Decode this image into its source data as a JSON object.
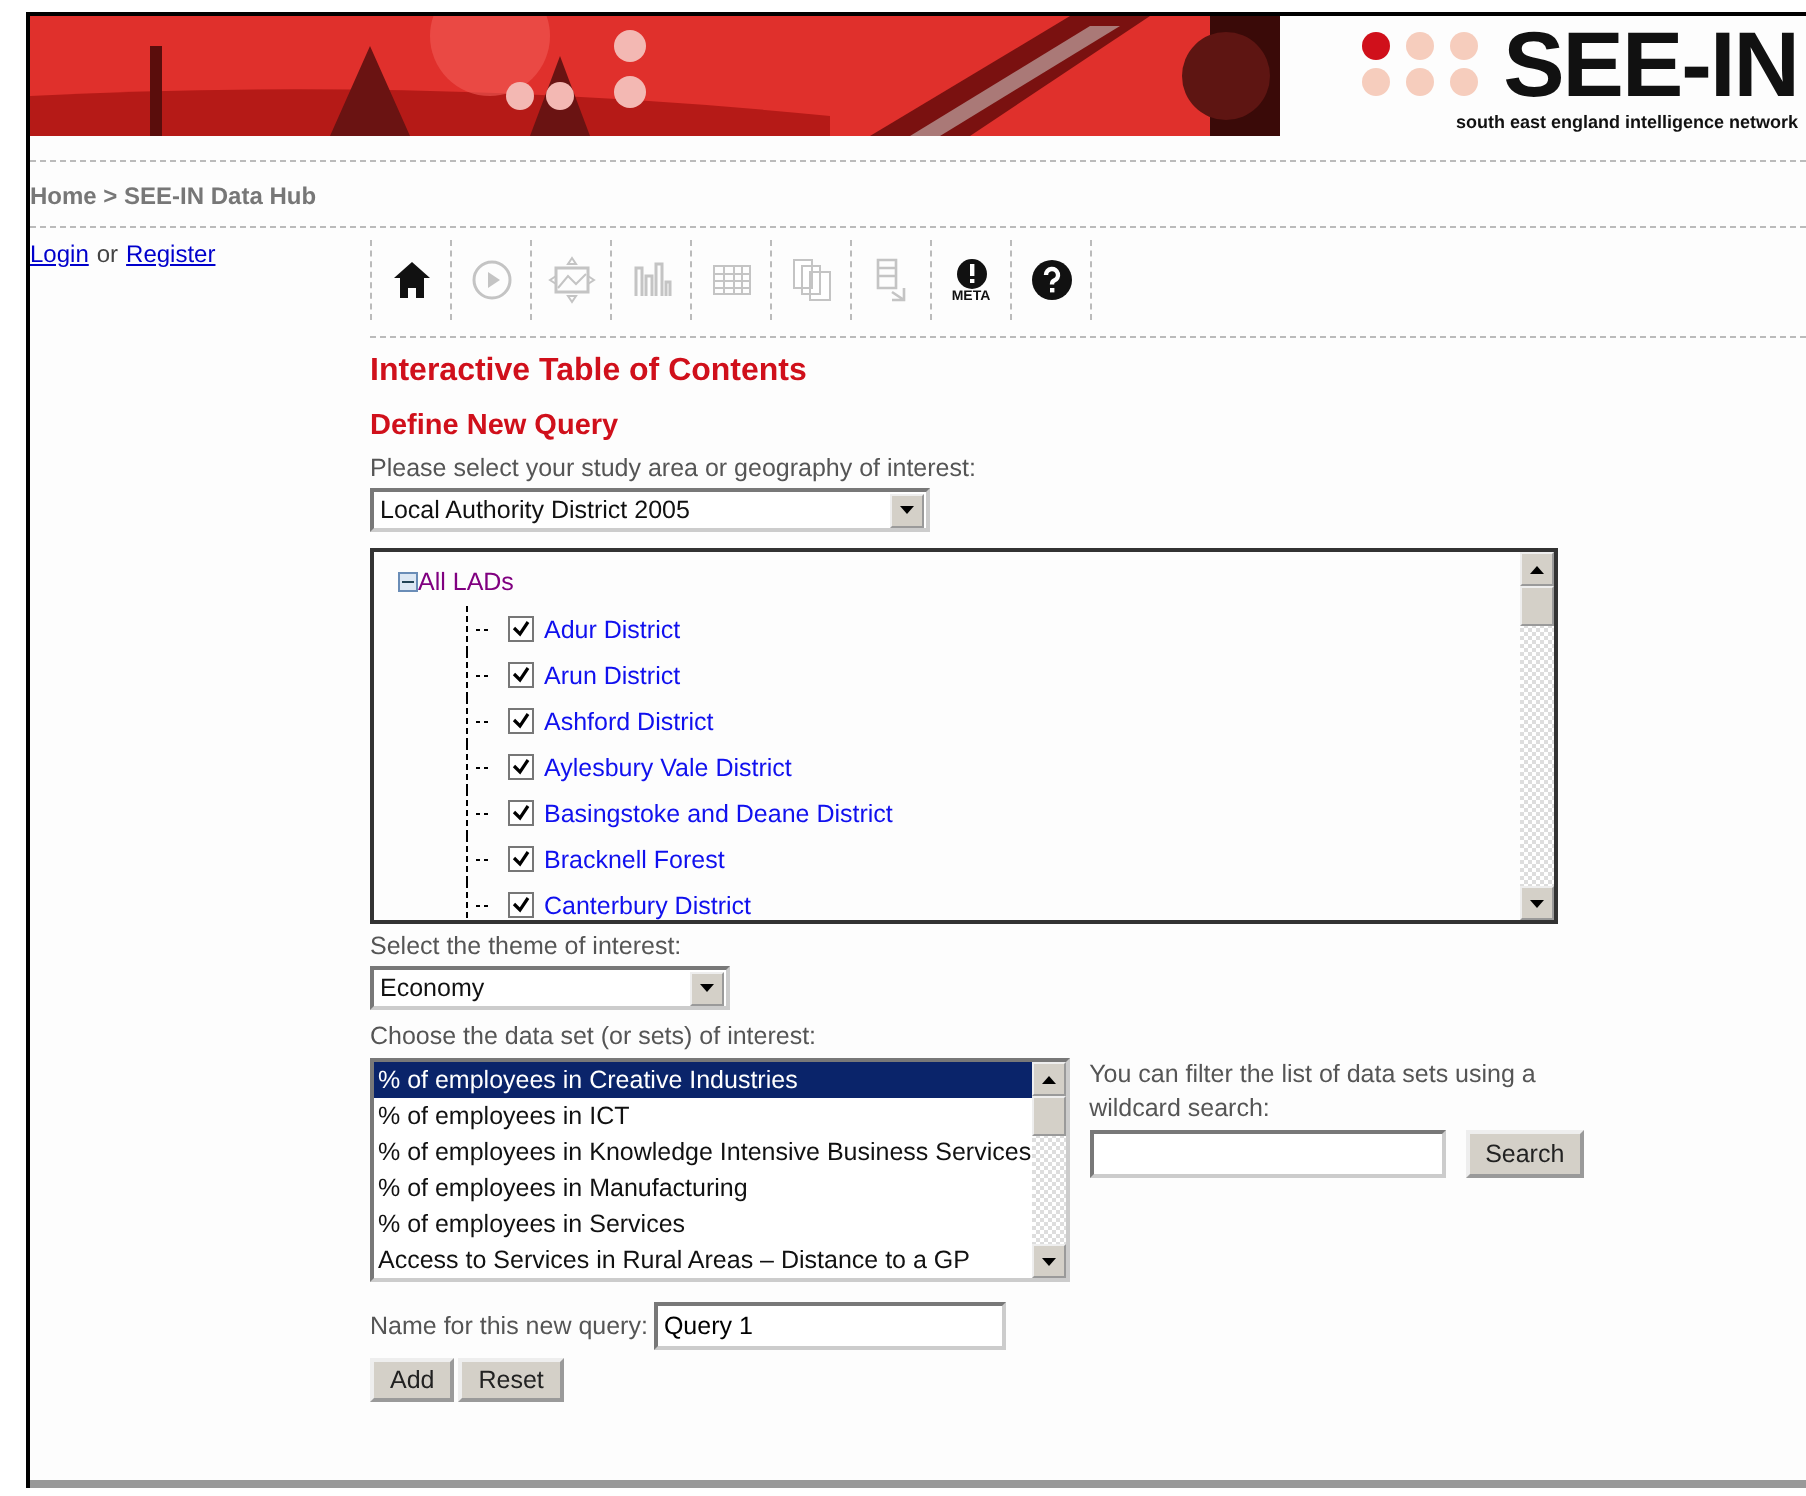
{
  "header": {
    "logo_title": "SEE-IN",
    "logo_tagline": "south east england intelligence network"
  },
  "breadcrumb": "Home > SEE-IN Data Hub",
  "account": {
    "login": "Login",
    "separator": "or",
    "register": "Register"
  },
  "toolbar": [
    {
      "kind": "home",
      "disabled": false
    },
    {
      "kind": "play",
      "disabled": true
    },
    {
      "kind": "map",
      "disabled": true
    },
    {
      "kind": "chart",
      "disabled": true
    },
    {
      "kind": "table",
      "disabled": true
    },
    {
      "kind": "reports",
      "disabled": true
    },
    {
      "kind": "export",
      "disabled": true
    },
    {
      "kind": "meta",
      "disabled": false,
      "label": "META"
    },
    {
      "kind": "help",
      "disabled": false
    }
  ],
  "title": "Interactive Table of Contents",
  "subtitle": "Define New Query",
  "geography": {
    "label": "Please select your study area or geography of interest:",
    "value": "Local Authority District 2005"
  },
  "tree": {
    "root": "All LADs",
    "expanded": true,
    "children": [
      {
        "label": "Adur District",
        "checked": true
      },
      {
        "label": "Arun District",
        "checked": true
      },
      {
        "label": "Ashford District",
        "checked": true
      },
      {
        "label": "Aylesbury Vale District",
        "checked": true
      },
      {
        "label": "Basingstoke and Deane District",
        "checked": true
      },
      {
        "label": "Bracknell Forest",
        "checked": true
      },
      {
        "label": "Canterbury District",
        "checked": true
      }
    ]
  },
  "theme": {
    "label": "Select the theme of interest:",
    "value": "Economy"
  },
  "datasets": {
    "label": "Choose the data set (or sets) of interest:",
    "items": [
      {
        "label": "% of employees in Creative Industries",
        "selected": true
      },
      {
        "label": "% of employees in ICT",
        "selected": false
      },
      {
        "label": "% of employees in Knowledge Intensive Business Services",
        "selected": false
      },
      {
        "label": "% of employees in Manufacturing",
        "selected": false
      },
      {
        "label": "% of employees in Services",
        "selected": false
      },
      {
        "label": "Access to Services in Rural Areas – Distance to a GP",
        "selected": false
      }
    ]
  },
  "filter": {
    "label": "You can filter the list of data sets using a wildcard search:",
    "button": "Search"
  },
  "query_name": {
    "label": "Name for this new query:",
    "value": "Query 1"
  },
  "buttons": [
    "Add",
    "Reset"
  ]
}
